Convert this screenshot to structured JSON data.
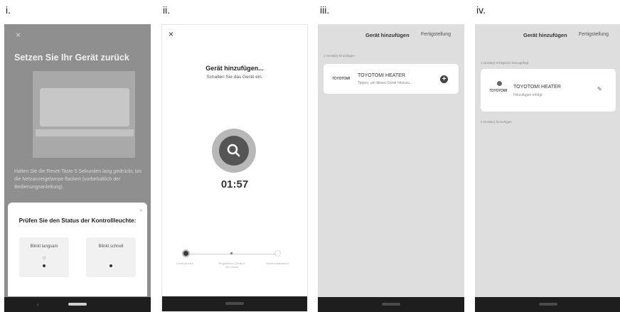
{
  "labels": [
    "i.",
    "ii.",
    "iii.",
    "iv."
  ],
  "screen1": {
    "close": "×",
    "title": "Setzen Sie Ihr Gerät zurück",
    "description": "Halten Sie die Reset-Taste 5 Sekunden lang gedrückt, bis die Netzanzeigelampe flackert (vorbehaltlich der Bedienungsanleitung).",
    "sheet_close": "×",
    "sheet_question": "Prüfen Sie den Status der Kontrollleuchte:",
    "option_slow": "Blinkt langsam",
    "option_fast": "Blinkt schnell"
  },
  "screen2": {
    "close": "×",
    "title": "Gerät hinzufügen...",
    "subtitle": "Schalten Sie das Gerät ein.",
    "timer": "01:57",
    "steps": [
      "Gerät suchen",
      "Registrieren Gerät in der Cloud",
      "Gerät initialisieren"
    ]
  },
  "screen3": {
    "title": "Gerät hinzufügen",
    "done": "Fertigstellung",
    "section": "1 Gerät(e) hinzufügen",
    "logo": "TOYOTOMI",
    "device_name": "TOYOTOMI HEATER",
    "device_sub": "Tippen, um dieses Gerät hinzuzu..."
  },
  "screen4": {
    "title": "Gerät hinzufügen",
    "done": "Fertigstellung",
    "section_success": "1 Gerät(e) erfolgreich hinzugefügt",
    "logo": "TOYOTOMI",
    "device_name": "TOYOTOMI HEATER",
    "device_sub": "Hinzufügen erfolgt",
    "section_add": "0 Gerät(e) hinzufügen"
  },
  "colors": {
    "overlay_gray": "#8f8f8f",
    "list_bg": "#dedede",
    "nav_bar": "#1e1e1e",
    "search_ring": "#b8b8b8",
    "search_core": "#555555"
  }
}
